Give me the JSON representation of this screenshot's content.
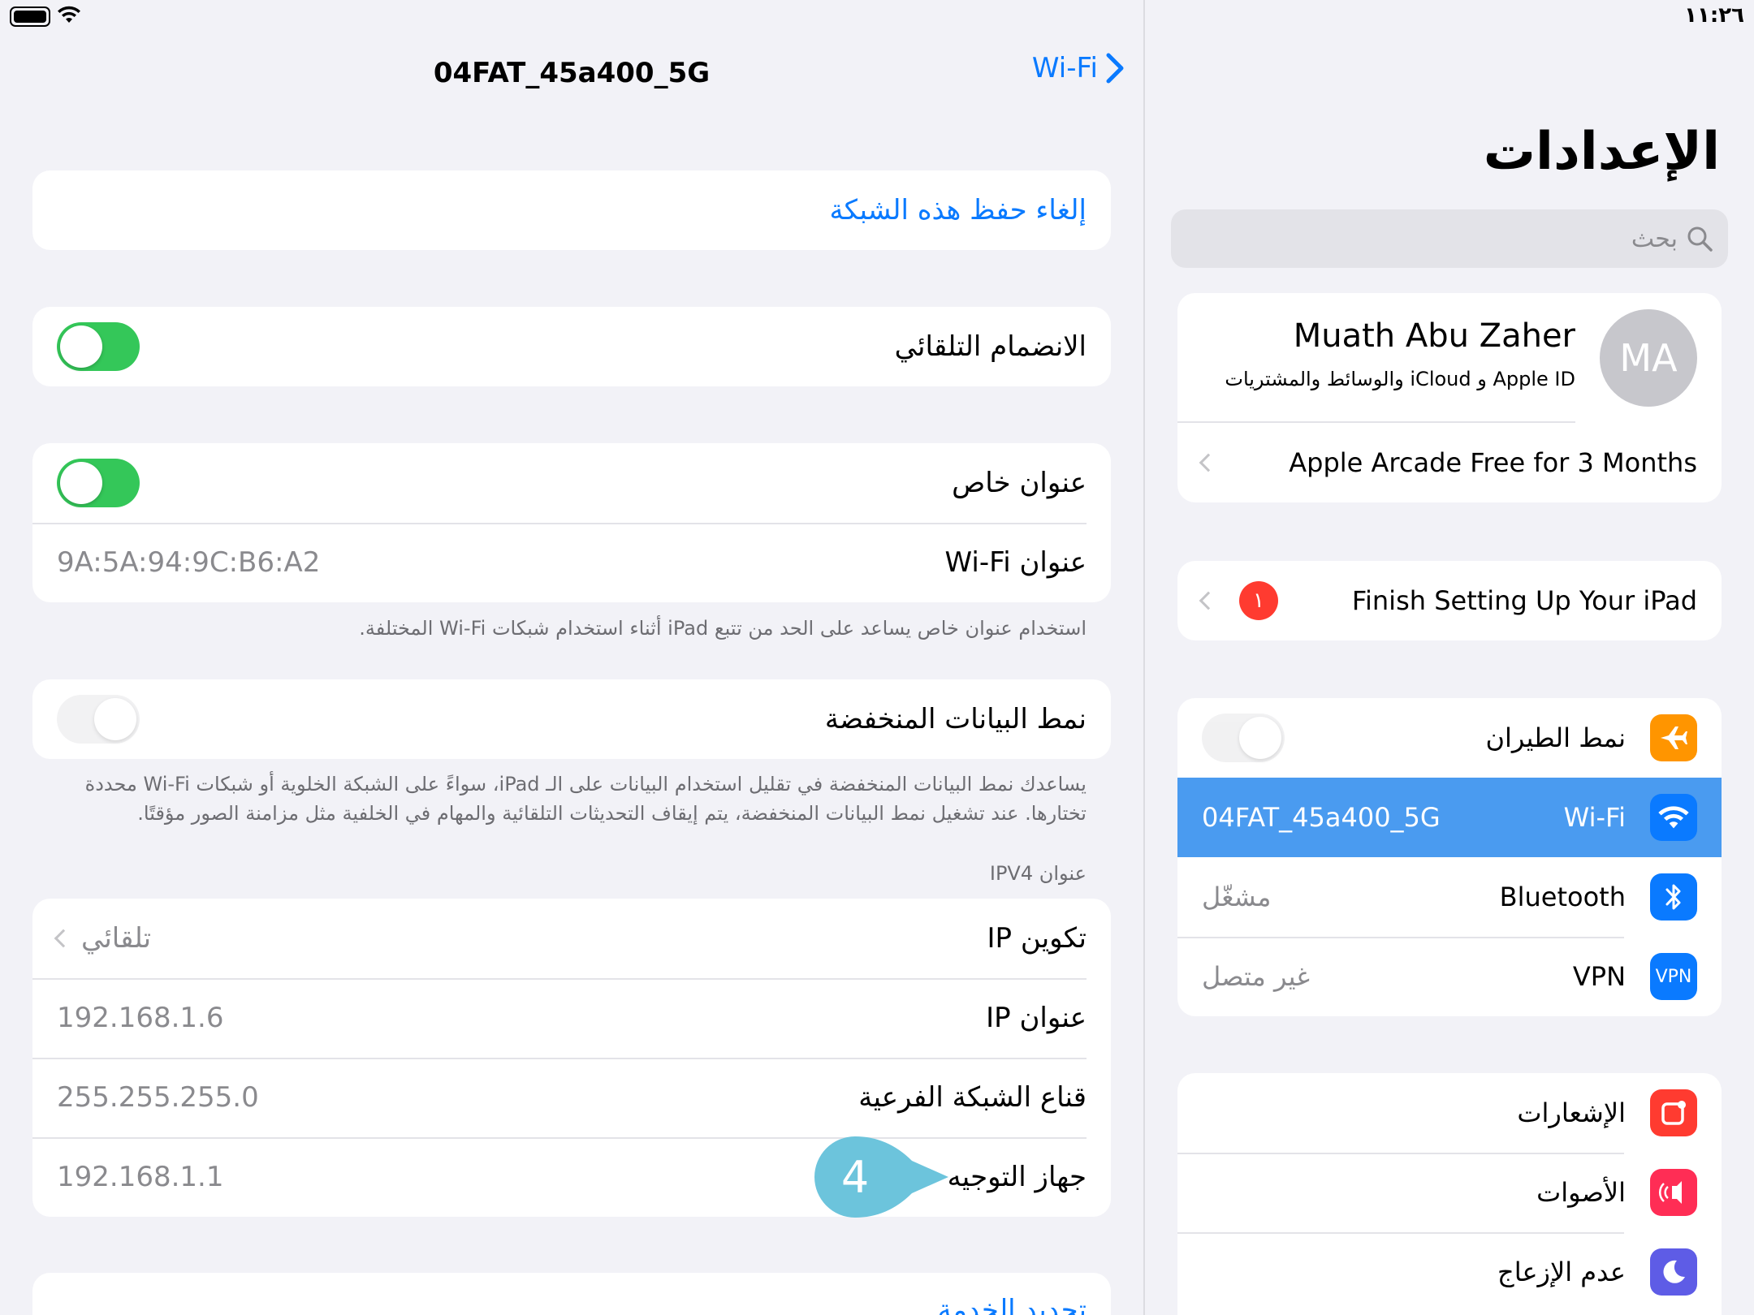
{
  "status_bar": {
    "time": "١١:٢٦"
  },
  "detail": {
    "nav_title": "04FAT_45a400_5G",
    "back_label": "Wi-Fi",
    "forget_network": "إلغاء حفظ هذه الشبكة",
    "auto_join": {
      "label": "الانضمام التلقائي",
      "on": true
    },
    "private_address": {
      "label": "عنوان خاص",
      "on": true
    },
    "wifi_address": {
      "label": "عنوان Wi-Fi",
      "value": "9A:5A:94:9C:B6:A2"
    },
    "private_footer": "استخدام عنوان خاص يساعد على الحد من تتبع iPad أثناء استخدام شبكات Wi-Fi المختلفة.",
    "low_data": {
      "label": "نمط البيانات المنخفضة",
      "on": false
    },
    "low_data_footer_1": "يساعدك نمط البيانات المنخفضة في تقليل استخدام البيانات على الـ iPad، سواءً على الشبكة الخلوية أو شبكات Wi-Fi محددة",
    "low_data_footer_2": "تختارها. عند تشغيل نمط البيانات المنخفضة، يتم إيقاف التحديثات التلقائية والمهام في الخلفية مثل مزامنة الصور مؤقتًا.",
    "ipv4_header": "عنوان IPV4",
    "ip_config": {
      "label": "تكوين IP",
      "value": "تلقائي"
    },
    "ip_address": {
      "label": "عنوان IP",
      "value": "192.168.1.6"
    },
    "subnet": {
      "label": "قناع الشبكة الفرعية",
      "value": "255.255.255.0"
    },
    "router": {
      "label": "جهاز التوجيه",
      "value": "192.168.1.1"
    },
    "renew_lease": "تجديد الخدمة",
    "callout_number": "4"
  },
  "master": {
    "title": "الإعدادات",
    "search_placeholder": "بحث",
    "profile": {
      "initials": "MA",
      "name": "Muath Abu Zaher",
      "subtitle": "Apple ID و iCloud والوسائط والمشتريات"
    },
    "arcade": "Apple Arcade Free for 3 Months",
    "finish_setup": {
      "label": "Finish Setting Up Your iPad",
      "badge": "١"
    },
    "airplane": {
      "label": "نمط الطيران",
      "on": false
    },
    "wifi": {
      "label": "Wi-Fi",
      "value": "04FAT_45a400_5G"
    },
    "bluetooth": {
      "label": "Bluetooth",
      "value": "مشغّل"
    },
    "vpn": {
      "label": "VPN",
      "value": "غير متصل",
      "icon_text": "VPN"
    },
    "notifications": "الإشعارات",
    "sounds": "الأصوات",
    "focus": "عدم الإزعاج"
  },
  "colors": {
    "accent": "#0a7aff",
    "selected_row": "#4a9bf0",
    "toggle_on": "#34c759",
    "callout": "#6cc4dc",
    "airplane_icon": "#ff9500",
    "wifi_icon": "#0a7aff",
    "bluetooth_icon": "#0a7aff",
    "vpn_icon": "#0a7aff",
    "notifications_icon": "#ff3b30",
    "sounds_icon": "#ff2d55",
    "focus_icon": "#5e5ce6"
  }
}
